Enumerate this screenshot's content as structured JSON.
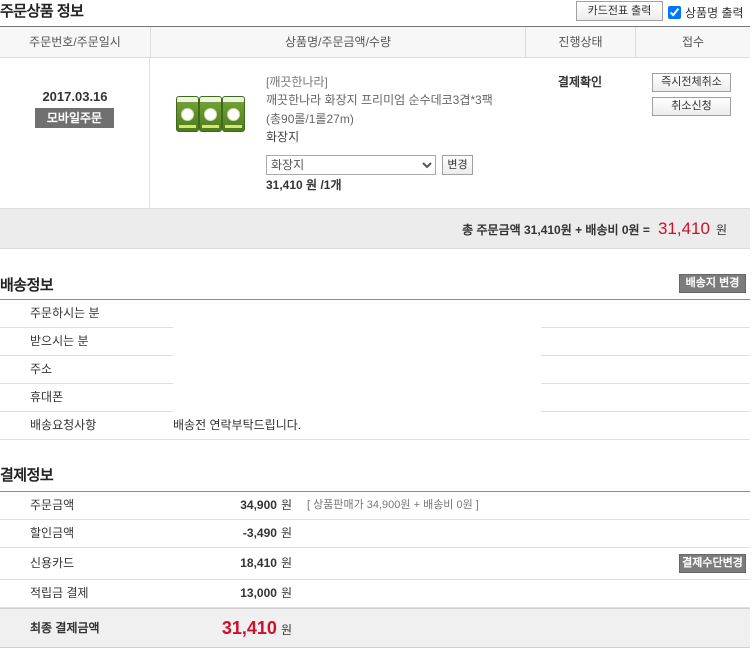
{
  "colors": {
    "accent_red": "#d0102b",
    "badge_gray": "#707070",
    "dark_button": "#7c7c7c",
    "header_bg": "#f7f7f7",
    "total_bg": "#ececec",
    "final_bg": "#f0f0f0"
  },
  "order_section": {
    "title": "주문상품 정보",
    "receipt_button": "카드전표 출력",
    "print_product_name": {
      "label": "상품명 출력",
      "checked": true
    }
  },
  "order_table": {
    "headers": [
      "주문번호/주문일시",
      "상품명/주문금액/수량",
      "진행상태",
      "접수"
    ],
    "order": {
      "date": "2017.03.16",
      "channel": "모바일주문",
      "status": "결제확인",
      "actions": [
        "즉시전체취소",
        "취소신청"
      ]
    },
    "product": {
      "brand": "[깨끗한나라]",
      "name": "깨끗한나라 화장지 프리미엄 순수데코3겹*3팩",
      "spec": "(총90롤/1롤27m)",
      "option": "화장지",
      "option_select": {
        "selected": "화장지"
      },
      "change_button": "변경",
      "price": "31,410",
      "price_unit": "원",
      "quantity": "/1개"
    },
    "total": {
      "summary": "총 주문금액 31,410원 + 배송비 0원 =",
      "amount": "31,410",
      "unit": "원"
    }
  },
  "shipping": {
    "title": "배송정보",
    "change_button": "배송지 변경",
    "rows": [
      {
        "label": "주문하시는 분"
      },
      {
        "label": "받으시는 분"
      },
      {
        "label": "주소"
      },
      {
        "label": "휴대폰"
      },
      {
        "label": "배송요청사항",
        "value": "배송전 연락부탁드립니다."
      }
    ]
  },
  "payment": {
    "title": "결제정보",
    "rows": [
      {
        "label": "주문금액",
        "amount": "34,900",
        "unit": "원",
        "note": "[ 상품판매가 34,900원 + 배송비 0원 ]"
      },
      {
        "label": "할인금액",
        "amount": "-3,490",
        "unit": "원"
      },
      {
        "label": "신용카드",
        "amount": "18,410",
        "unit": "원",
        "button": "결제수단변경"
      },
      {
        "label": "적립금 결제",
        "amount": "13,000",
        "unit": "원"
      }
    ],
    "final": {
      "label": "최종 결제금액",
      "amount": "31,410",
      "unit": "원"
    }
  }
}
